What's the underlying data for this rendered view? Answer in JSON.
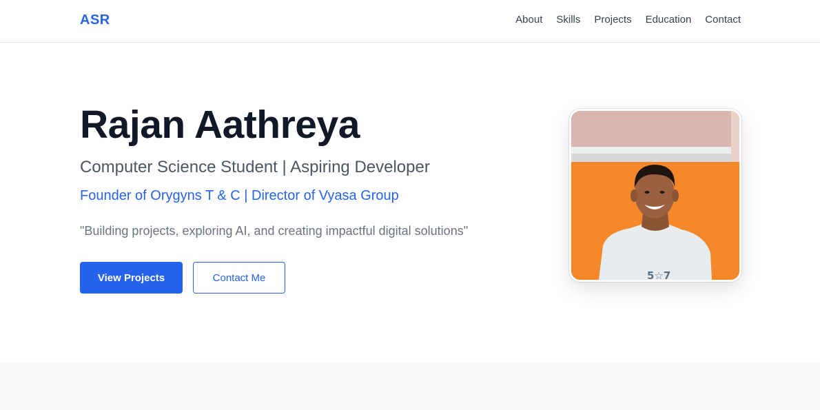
{
  "brand": {
    "logo": "ASR",
    "accent": "#2563eb"
  },
  "nav": {
    "items": [
      {
        "label": "About"
      },
      {
        "label": "Skills"
      },
      {
        "label": "Projects"
      },
      {
        "label": "Education"
      },
      {
        "label": "Contact"
      }
    ]
  },
  "hero": {
    "name": "Rajan Aathreya",
    "subtitle": "Computer Science Student | Aspiring Developer",
    "roles": "Founder of Orygyns T & C | Director of Vyasa Group",
    "quote": "\"Building projects, exploring AI, and creating impactful digital solutions\"",
    "buttons": {
      "primary": "View Projects",
      "secondary": "Contact Me"
    },
    "photo": {
      "shirt_text": "5☆7"
    }
  }
}
